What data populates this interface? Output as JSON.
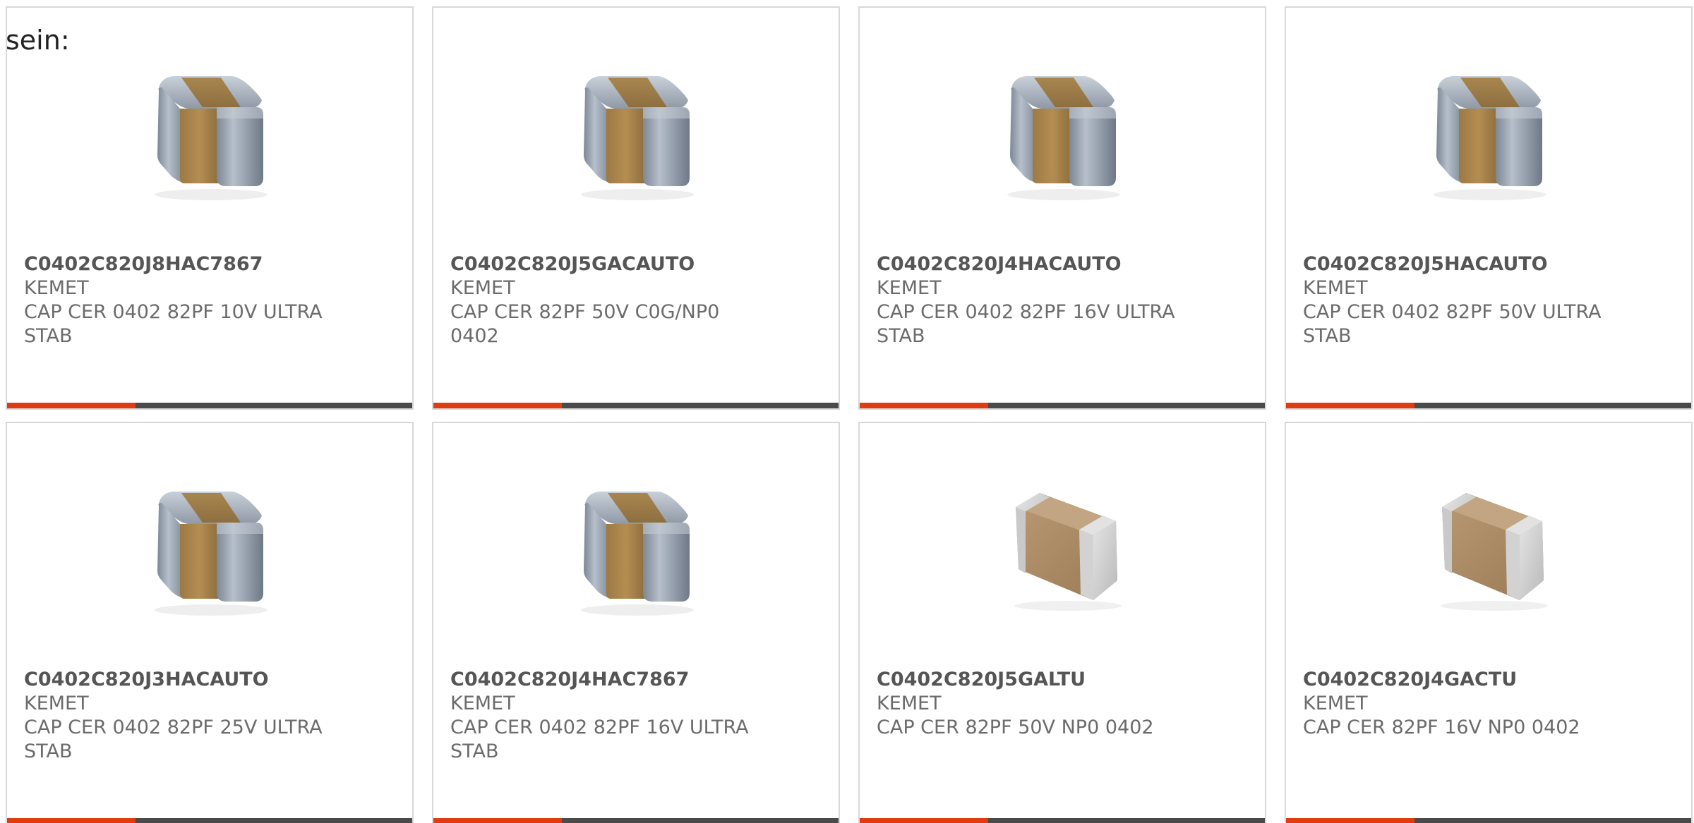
{
  "intro_text": "sein:",
  "colors": {
    "accent": "#e03c12",
    "bar": "#4a4a4a",
    "card_border": "#d8d8d8",
    "text": "#6b6b6b"
  },
  "products": [
    {
      "part_number": "C0402C820J8HAC7867",
      "manufacturer": "KEMET",
      "description": "CAP CER 0402 82PF 10V ULTRA STAB",
      "image": "metallic-capacitor-icon"
    },
    {
      "part_number": "C0402C820J5GACAUTO",
      "manufacturer": "KEMET",
      "description": "CAP CER 82PF 50V C0G/NP0 0402",
      "image": "metallic-capacitor-icon"
    },
    {
      "part_number": "C0402C820J4HACAUTO",
      "manufacturer": "KEMET",
      "description": "CAP CER 0402 82PF 16V ULTRA STAB",
      "image": "metallic-capacitor-icon"
    },
    {
      "part_number": "C0402C820J5HACAUTO",
      "manufacturer": "KEMET",
      "description": "CAP CER 0402 82PF 50V ULTRA STAB",
      "image": "metallic-capacitor-icon"
    },
    {
      "part_number": "C0402C820J3HACAUTO",
      "manufacturer": "KEMET",
      "description": "CAP CER 0402 82PF 25V ULTRA STAB",
      "image": "metallic-capacitor-icon"
    },
    {
      "part_number": "C0402C820J4HAC7867",
      "manufacturer": "KEMET",
      "description": "CAP CER 0402 82PF 16V ULTRA STAB",
      "image": "metallic-capacitor-icon"
    },
    {
      "part_number": "C0402C820J5GALTU",
      "manufacturer": "KEMET",
      "description": "CAP CER 82PF 50V NP0 0402",
      "image": "flat-capacitor-icon"
    },
    {
      "part_number": "C0402C820J4GACTU",
      "manufacturer": "KEMET",
      "description": "CAP CER 82PF 16V NP0 0402",
      "image": "flat-capacitor-icon"
    }
  ]
}
